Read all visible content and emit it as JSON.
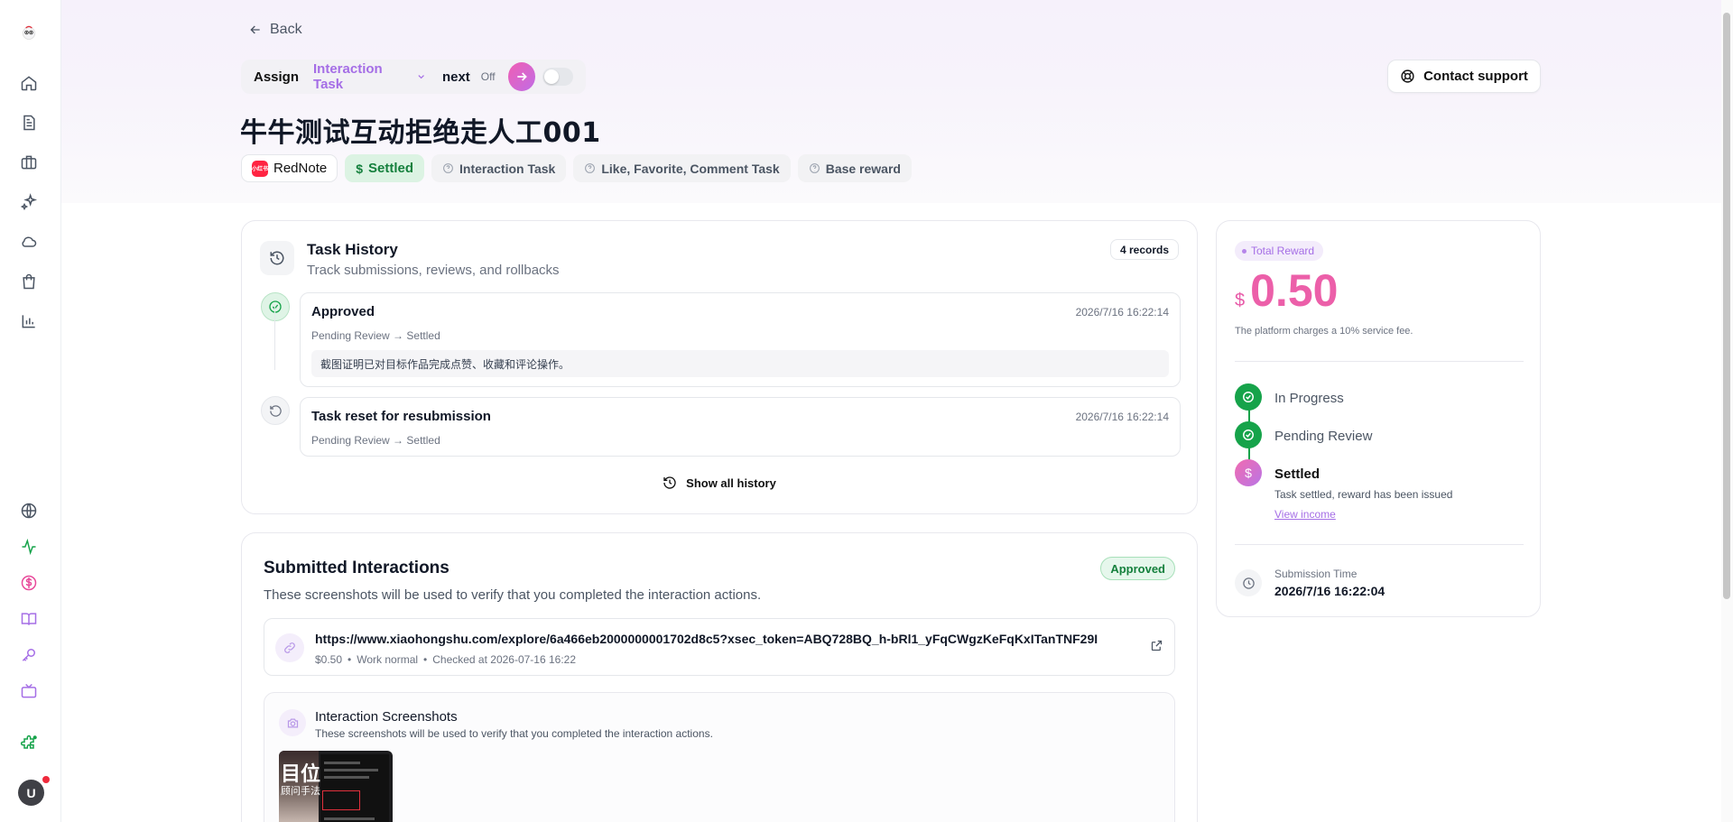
{
  "sidebar": {
    "items": [
      {
        "name": "logo",
        "icon": "logo-icon"
      },
      {
        "name": "home",
        "icon": "home-icon"
      },
      {
        "name": "documents",
        "icon": "document-icon"
      },
      {
        "name": "briefcase",
        "icon": "briefcase-icon"
      },
      {
        "name": "sparkles",
        "icon": "sparkles-icon"
      },
      {
        "name": "cloud",
        "icon": "cloud-icon"
      },
      {
        "name": "shopping-bag",
        "icon": "shopping-bag-icon"
      },
      {
        "name": "stats",
        "icon": "bar-chart-icon"
      },
      {
        "name": "globe",
        "icon": "globe-icon"
      },
      {
        "name": "activity",
        "icon": "activity-icon"
      },
      {
        "name": "dollar",
        "icon": "dollar-icon"
      },
      {
        "name": "book",
        "icon": "book-icon"
      },
      {
        "name": "key",
        "icon": "key-icon"
      },
      {
        "name": "tv",
        "icon": "tv-icon"
      },
      {
        "name": "puzzle",
        "icon": "puzzle-icon"
      }
    ],
    "avatar_letter": "U"
  },
  "header": {
    "back_label": "Back",
    "assign_label": "Assign",
    "task_select": "Interaction Task",
    "next_label": "next",
    "auto_state": "Off",
    "support_label": "Contact support"
  },
  "task": {
    "title": "牛牛测试互动拒绝走人工001",
    "tags": {
      "platform": "RedNote",
      "platform_logo_text": "小红书",
      "status": "Settled",
      "type": "Interaction Task",
      "actions": "Like, Favorite, Comment Task",
      "reward_type": "Base reward"
    }
  },
  "history": {
    "title": "Task History",
    "subtitle": "Track submissions, reviews, and rollbacks",
    "records": "4 records",
    "items": [
      {
        "title": "Approved",
        "time": "2026/7/16 16:22:14",
        "flow": "Pending Review → Settled",
        "note": "截图证明已对目标作品完成点赞、收藏和评论操作。"
      },
      {
        "title": "Task reset for resubmission",
        "time": "2026/7/16 16:22:14",
        "flow": "Pending Review → Settled"
      }
    ],
    "show_all": "Show all history"
  },
  "interactions": {
    "title": "Submitted Interactions",
    "subtitle": "These screenshots will be used to verify that you completed the interaction actions.",
    "status": "Approved",
    "link": {
      "url": "https://www.xiaohongshu.com/explore/6a466eb2000000001702d8c5?xsec_token=ABQ728BQ_h-bRl1_yFqCWgzKeFqKxITanTNF29I",
      "amount": "$0.50",
      "work_state": "Work normal",
      "checked": "Checked at 2026-07-16 16:22"
    },
    "screenshots": {
      "title": "Interaction Screenshots",
      "subtitle": "These screenshots will be used to verify that you completed the interaction actions.",
      "thumb_text_1": "目位",
      "thumb_text_2": "顾问手法"
    }
  },
  "reward": {
    "badge": "Total Reward",
    "currency": "$",
    "amount": "0.50",
    "fee_note": "The platform charges a 10% service fee.",
    "steps": [
      {
        "label": "In Progress"
      },
      {
        "label": "Pending Review"
      },
      {
        "label": "Settled",
        "desc": "Task settled, reward has been issued",
        "link": "View income"
      }
    ],
    "submission_label": "Submission Time",
    "submission_time": "2026/7/16 16:22:04"
  },
  "colors": {
    "accent_purple": "#a56ee6",
    "accent_pink": "#ec5fa9",
    "success_green": "#16a34a"
  }
}
